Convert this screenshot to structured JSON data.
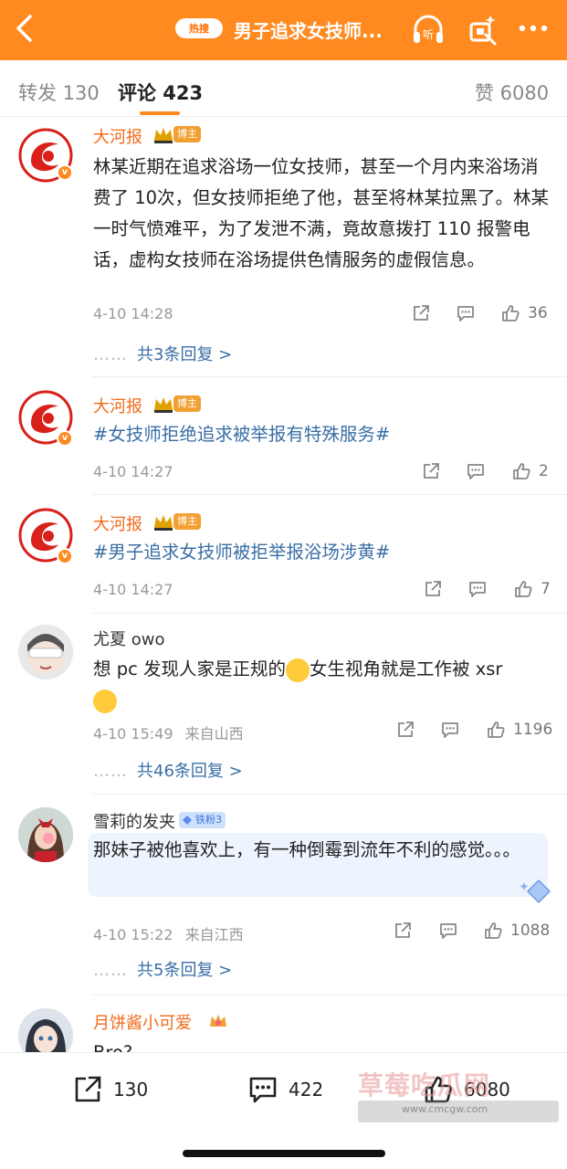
{
  "header": {
    "hot_badge": "热搜",
    "title": "男子追求女技师...",
    "listen_label": "听"
  },
  "tabs": [
    {
      "label": "转发 130"
    },
    {
      "label": "评论 423"
    },
    {
      "label": "赞 6080"
    }
  ],
  "comments": [
    {
      "user": "大河报",
      "tag": "博主",
      "text": "林某近期在追求浴场一位女技师，甚至一个月内来浴场消费了 10次，但女技师拒绝了他，甚至将林某拉黑了。林某一时气愤难平，为了发泄不满，竟故意拨打 110 报警电话，虚构女技师在浴场提供色情服务的虚假信息。",
      "time": "4-10 14:28",
      "likes": "36",
      "replies": "共3条回复 >"
    },
    {
      "user": "大河报",
      "tag": "博主",
      "text": "#女技师拒绝追求被举报有特殊服务#",
      "time": "4-10 14:27",
      "likes": "2"
    },
    {
      "user": "大河报",
      "tag": "博主",
      "text": "#男子追求女技师被拒举报浴场涉黄#",
      "time": "4-10 14:27",
      "likes": "7"
    },
    {
      "user": "尤夏 owo",
      "text_a": "想 pc 发现人家是正规的",
      "text_b": "女生视角就是工作被 xsr",
      "time": "4-10 15:49",
      "location": "来自山西",
      "likes": "1196",
      "replies": "共46条回复 >"
    },
    {
      "user": "雪莉的发夹",
      "tag": "铁粉3",
      "text": "那妹子被他喜欢上，有一种倒霉到流年不利的感觉。。。",
      "time": "4-10 15:22",
      "location": "来自江西",
      "likes": "1088",
      "replies": "共5条回复 >"
    },
    {
      "user": "月饼酱小可爱",
      "text": "Bro?"
    }
  ],
  "reply_dots": "……",
  "bottom_bar": {
    "repost": "130",
    "comment": "422",
    "like": "6080"
  },
  "watermark": {
    "line1": "草莓吃瓜网",
    "line2": "www.cmcgw.com"
  },
  "colors": {
    "accent": "#ff8a1f",
    "topic": "#3a6ea5",
    "vip_name": "#f06a1a"
  }
}
